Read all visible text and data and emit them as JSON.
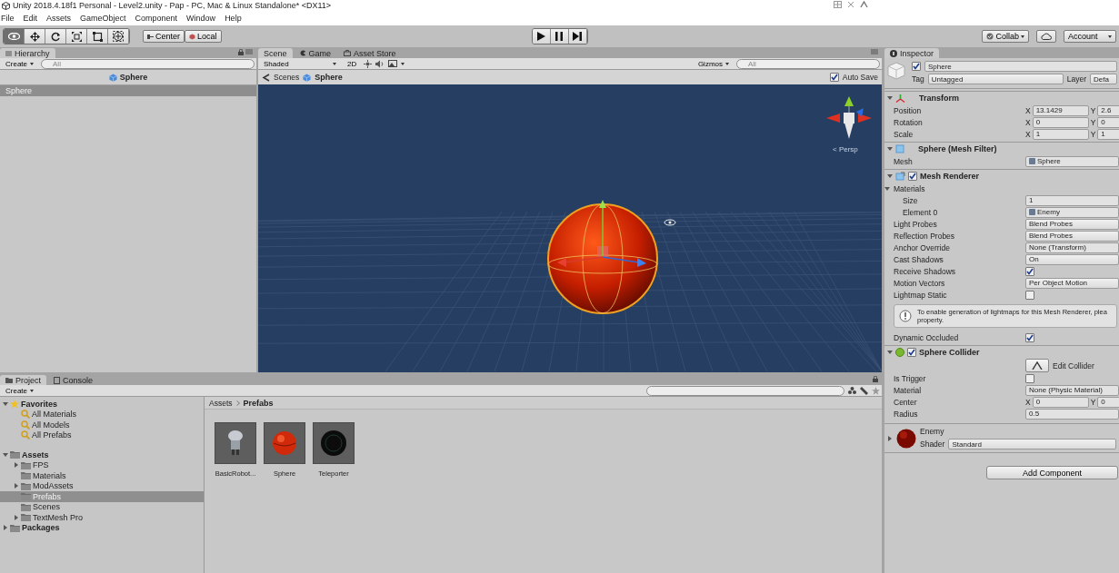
{
  "window": {
    "title": "Unity 2018.4.18f1 Personal - Level2.unity - Pap - PC, Mac & Linux Standalone* <DX11>"
  },
  "menu": [
    "File",
    "Edit",
    "Assets",
    "GameObject",
    "Component",
    "Window",
    "Help"
  ],
  "toolbar": {
    "tools": [
      {
        "kind": "view",
        "selected": true
      },
      {
        "kind": "move",
        "selected": false
      },
      {
        "kind": "rotate",
        "selected": false
      },
      {
        "kind": "scale",
        "selected": false
      },
      {
        "kind": "rect",
        "selected": false
      },
      {
        "kind": "transform",
        "selected": false
      }
    ],
    "pivot": [
      {
        "kind": "pivot",
        "label": "Center"
      },
      {
        "kind": "space",
        "label": "Local"
      }
    ],
    "playback": [
      {
        "kind": "play"
      },
      {
        "kind": "pause"
      },
      {
        "kind": "step"
      }
    ],
    "collab": "Collab",
    "account": "Account"
  },
  "hierarchy": {
    "tab": "Hierarchy",
    "create": "Create",
    "search_placeholder": "All",
    "scene": "Sphere",
    "items": [
      {
        "label": "Sphere",
        "selected": true
      }
    ]
  },
  "scene": {
    "tabs": [
      {
        "kind": "scene",
        "label": "Scene",
        "selected": true
      },
      {
        "kind": "game",
        "label": "Game",
        "selected": false
      },
      {
        "kind": "store",
        "label": "Asset Store",
        "selected": false
      }
    ],
    "shading": "Shaded",
    "mode_2d": "2D",
    "gizmos": "Gizmos",
    "search_placeholder": "All",
    "breadcrumb": [
      "Scenes",
      "Sphere"
    ],
    "auto_save": {
      "label": "Auto Save",
      "checked": true
    },
    "projection": "< Persp"
  },
  "inspector": {
    "tab": "Inspector",
    "object": {
      "active": true,
      "name": "Sphere",
      "tag_label": "Tag",
      "tag": "Untagged",
      "layer_label": "Layer",
      "layer": "Defa"
    },
    "components": [
      {
        "kind": "transform",
        "title": "Transform",
        "expanded": true,
        "rows": [
          {
            "kind": "vector",
            "label": "Position",
            "values": [
              {
                "axis": "X",
                "value": "13.1429"
              },
              {
                "axis": "Y",
                "value": "2.6"
              }
            ]
          },
          {
            "kind": "vector",
            "label": "Rotation",
            "values": [
              {
                "axis": "X",
                "value": "0"
              },
              {
                "axis": "Y",
                "value": "0"
              }
            ]
          },
          {
            "kind": "vector",
            "label": "Scale",
            "values": [
              {
                "axis": "X",
                "value": "1"
              },
              {
                "axis": "Y",
                "value": "1"
              }
            ]
          }
        ]
      },
      {
        "kind": "filter",
        "title": "Sphere (Mesh Filter)",
        "expanded": true,
        "rows": [
          {
            "kind": "object",
            "label": "Mesh",
            "value": "Sphere"
          }
        ]
      },
      {
        "kind": "renderer",
        "title": "Mesh Renderer",
        "expanded": true,
        "enabled": true,
        "rows": [
          {
            "kind": "foldout",
            "label": "Materials",
            "expanded": true,
            "children": [
              {
                "kind": "field",
                "label": "Size",
                "value": "1"
              },
              {
                "kind": "object",
                "label": "Element 0",
                "value": "Enemy"
              }
            ]
          },
          {
            "kind": "dropdown",
            "label": "Light Probes",
            "value": "Blend Probes"
          },
          {
            "kind": "dropdown",
            "label": "Reflection Probes",
            "value": "Blend Probes"
          },
          {
            "kind": "field",
            "label": "Anchor Override",
            "value": "None (Transform)"
          },
          {
            "kind": "dropdown",
            "label": "Cast Shadows",
            "value": "On"
          },
          {
            "kind": "checkbox",
            "label": "Receive Shadows",
            "checked": true
          },
          {
            "kind": "dropdown",
            "label": "Motion Vectors",
            "value": "Per Object Motion"
          },
          {
            "kind": "checkbox",
            "label": "Lightmap Static",
            "checked": false
          },
          {
            "kind": "note",
            "lines": [
              "To enable generation of lightmaps for this Mesh Renderer, plea",
              "property."
            ]
          },
          {
            "kind": "checkbox",
            "label": "Dynamic Occluded",
            "checked": true
          }
        ]
      },
      {
        "kind": "collider",
        "title": "Sphere Collider",
        "expanded": true,
        "enabled": true,
        "rows": [
          {
            "kind": "button",
            "label": "Edit Collider"
          },
          {
            "kind": "checkbox",
            "label": "Is Trigger",
            "checked": false
          },
          {
            "kind": "field",
            "label": "Material",
            "value": "None (Physic Material)"
          },
          {
            "kind": "vector",
            "label": "Center",
            "values": [
              {
                "axis": "X",
                "value": "0"
              },
              {
                "axis": "Y",
                "value": "0"
              }
            ]
          },
          {
            "kind": "field",
            "label": "Radius",
            "value": "0.5"
          }
        ]
      }
    ],
    "material": {
      "name": "Enemy",
      "shader_label": "Shader",
      "shader": "Standard",
      "expanded": false
    },
    "add_component": "Add Component"
  },
  "project": {
    "tabs": [
      {
        "kind": "project",
        "label": "Project",
        "selected": true
      },
      {
        "kind": "console",
        "label": "Console",
        "selected": false
      }
    ],
    "create": "Create",
    "tree": [
      {
        "kind": "star",
        "label": "Favorites",
        "expanded": true,
        "selected": false,
        "children": [
          {
            "kind": "search",
            "label": "All Materials",
            "selected": false
          },
          {
            "kind": "search",
            "label": "All Models",
            "selected": false
          },
          {
            "kind": "search",
            "label": "All Prefabs",
            "selected": false
          }
        ]
      },
      {
        "kind": "folder",
        "label": "Assets",
        "expanded": true,
        "selected": false,
        "children": [
          {
            "kind": "folder",
            "label": "FPS",
            "expanded": false,
            "selected": false
          },
          {
            "kind": "folder",
            "label": "Materials",
            "selected": false
          },
          {
            "kind": "folder",
            "label": "ModAssets",
            "expanded": false,
            "selected": false
          },
          {
            "kind": "folder",
            "label": "Prefabs",
            "selected": true
          },
          {
            "kind": "folder",
            "label": "Scenes",
            "selected": false
          },
          {
            "kind": "folder",
            "label": "TextMesh Pro",
            "expanded": false,
            "selected": false
          }
        ]
      },
      {
        "kind": "folder",
        "label": "Packages",
        "expanded": false,
        "selected": false
      }
    ],
    "breadcrumb": [
      "Assets",
      "Prefabs"
    ],
    "assets": [
      {
        "kind": "robot",
        "label": "BasicRobot..."
      },
      {
        "kind": "ball",
        "label": "Sphere"
      },
      {
        "kind": "portal",
        "label": "Teleporter"
      }
    ]
  }
}
